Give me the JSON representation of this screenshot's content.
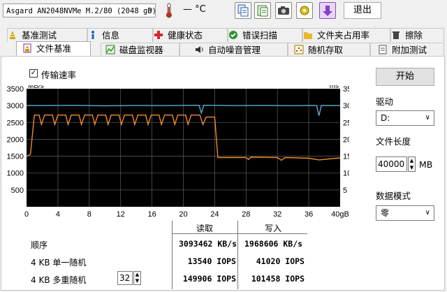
{
  "toolbar": {
    "drive": "Asgard AN2048NVMe M.2/80 (2048 gB)",
    "temperature": "— °C",
    "exit_label": "退出"
  },
  "tabs_row1": [
    "基准测试",
    "信息",
    "健康状态",
    "错误扫描",
    "文件夹占用率",
    "擦除"
  ],
  "tabs_row2": [
    "文件基准",
    "磁盘监视器",
    "自动噪音管理",
    "随机存取",
    "附加测试"
  ],
  "active_tab": "文件基准",
  "transfer_rate_label": "传输速率",
  "chart_data": {
    "type": "line",
    "xlabel": "",
    "x_ticks": [
      "0",
      "4",
      "8",
      "12",
      "16",
      "20",
      "24",
      "28",
      "32",
      "36",
      "40gB"
    ],
    "xlim": [
      0,
      40
    ],
    "y_left_unit": "MB/s",
    "y_left_ticks": [
      "500",
      "1000",
      "1500",
      "2000",
      "2500",
      "3000",
      "3500"
    ],
    "ylim_left": [
      0,
      3500
    ],
    "y_right_unit": "ms",
    "y_right_ticks": [
      "5",
      "10",
      "15",
      "20",
      "25",
      "30",
      "35"
    ],
    "ylim_right": [
      0,
      35
    ],
    "grid": true,
    "colors": {
      "read": "#5aaed0",
      "write": "#f08a2c",
      "grid": "#555555",
      "bg": "#000000"
    },
    "series": [
      {
        "name": "读取",
        "axis": "left",
        "points": [
          [
            0,
            3005
          ],
          [
            2,
            3000
          ],
          [
            6,
            3008
          ],
          [
            10,
            2995
          ],
          [
            14,
            3005
          ],
          [
            18,
            3000
          ],
          [
            22,
            3010
          ],
          [
            22.3,
            2780
          ],
          [
            22.6,
            3010
          ],
          [
            26,
            3000
          ],
          [
            30,
            3005
          ],
          [
            34,
            2998
          ],
          [
            36,
            3005
          ],
          [
            37,
            3000
          ],
          [
            37.3,
            2700
          ],
          [
            37.6,
            3005
          ],
          [
            40,
            3000
          ]
        ]
      },
      {
        "name": "写入",
        "axis": "right",
        "points": [
          [
            0,
            15
          ],
          [
            0.5,
            15.5
          ],
          [
            1,
            27.2
          ],
          [
            1.6,
            27.2
          ],
          [
            1.9,
            24.4
          ],
          [
            2.3,
            27.2
          ],
          [
            3.3,
            27.2
          ],
          [
            3.6,
            24.4
          ],
          [
            4,
            27.2
          ],
          [
            5,
            27.2
          ],
          [
            5.3,
            24.4
          ],
          [
            5.7,
            27.2
          ],
          [
            6.7,
            27.2
          ],
          [
            7,
            24.4
          ],
          [
            7.4,
            27.2
          ],
          [
            8.4,
            27.2
          ],
          [
            8.7,
            24.4
          ],
          [
            9.1,
            27.2
          ],
          [
            10.1,
            27.2
          ],
          [
            10.4,
            24.4
          ],
          [
            10.8,
            27.2
          ],
          [
            11.8,
            27.2
          ],
          [
            12.1,
            24.4
          ],
          [
            12.5,
            27.2
          ],
          [
            13.5,
            27.2
          ],
          [
            13.8,
            24.4
          ],
          [
            14.2,
            27.2
          ],
          [
            15.2,
            27.2
          ],
          [
            15.5,
            24.4
          ],
          [
            15.9,
            27.2
          ],
          [
            16.9,
            27.2
          ],
          [
            17.2,
            24.4
          ],
          [
            17.6,
            27.2
          ],
          [
            18.6,
            27.2
          ],
          [
            18.9,
            24.4
          ],
          [
            19.3,
            27.2
          ],
          [
            20.3,
            27.2
          ],
          [
            20.6,
            24.4
          ],
          [
            21,
            27.2
          ],
          [
            22.1,
            27.2
          ],
          [
            22.5,
            24.4
          ],
          [
            22.9,
            26.6
          ],
          [
            24,
            26.6
          ],
          [
            24.4,
            14.6
          ],
          [
            28,
            14.6
          ],
          [
            28.3,
            14.0
          ],
          [
            28.6,
            14.7
          ],
          [
            32,
            14.6
          ],
          [
            32.5,
            13.8
          ],
          [
            33,
            14.6
          ],
          [
            36,
            14.4
          ],
          [
            37.3,
            13.9
          ],
          [
            40,
            14.5
          ]
        ]
      }
    ]
  },
  "controls": {
    "start_label": "开始",
    "drive_label": "驱动",
    "drive_value": "D:",
    "file_length_label": "文件长度",
    "file_length_value": "40000",
    "file_length_unit": "MB",
    "data_mode_label": "数据模式",
    "data_mode_value": "零"
  },
  "results": {
    "header_read": "读取",
    "header_write": "写入",
    "rows": [
      {
        "label": "顺序",
        "read": "3093462 KB/s",
        "write": "1968606 KB/s"
      },
      {
        "label": "4 KB 单一随机",
        "read": "13540 IOPS",
        "write": "41020 IOPS"
      },
      {
        "label": "4 KB 多重随机",
        "read": "149906 IOPS",
        "write": "101458 IOPS"
      }
    ],
    "queue_depth": "32"
  }
}
